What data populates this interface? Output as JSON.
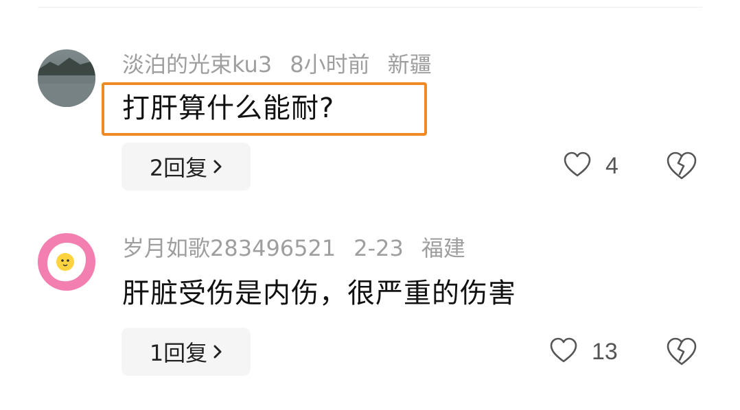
{
  "comments": [
    {
      "username": "淡泊的光束ku3",
      "time": "8小时前",
      "location": "新疆",
      "text": "打肝算什么能耐?",
      "reply_label": "2回复",
      "likes": "4",
      "highlighted": true
    },
    {
      "username": "岁月如歌283496521",
      "time": "2-23",
      "location": "福建",
      "text": "肝脏受伤是内伤，很严重的伤害",
      "reply_label": "1回复",
      "likes": "13",
      "highlighted": false
    }
  ],
  "colors": {
    "highlight_border": "#f08a24",
    "meta_text": "#9e9e9e",
    "reply_bg": "#f5f5f5"
  },
  "icons": {
    "like": "heart-outline-icon",
    "dislike": "broken-heart-icon",
    "reply_arrow": "chevron-right-icon"
  }
}
